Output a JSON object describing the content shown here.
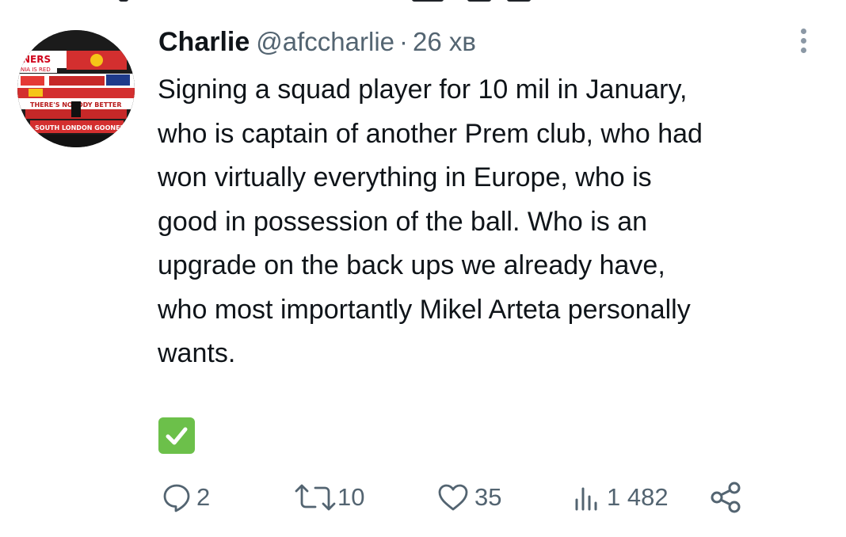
{
  "tweet": {
    "author_name": "Charlie",
    "handle": "@afccharlie",
    "separator": "·",
    "time": "26 хв",
    "text_lines": [
      "Signing a squad player for 10 mil in January,",
      "who is captain of another Prem club, who had",
      "won virtually everything in Europe, who is",
      "good in possession of the ball. Who is an",
      "upgrade on the back ups we already have,",
      "who most importantly Mikel Arteta personally",
      "wants."
    ],
    "emoji": "check-mark-button"
  },
  "avatar": {
    "banner_texts": [
      "NERS",
      "NIA IS RED",
      "THERE'S NOBODY BETTER",
      "SOUTH LONDON GOONERS"
    ]
  },
  "actions": {
    "reply_count": "2",
    "retweet_count": "10",
    "like_count": "35",
    "views_count": "1 482"
  },
  "colors": {
    "text": "#0f1419",
    "secondary": "#536471",
    "check_green": "#6cc04a"
  }
}
